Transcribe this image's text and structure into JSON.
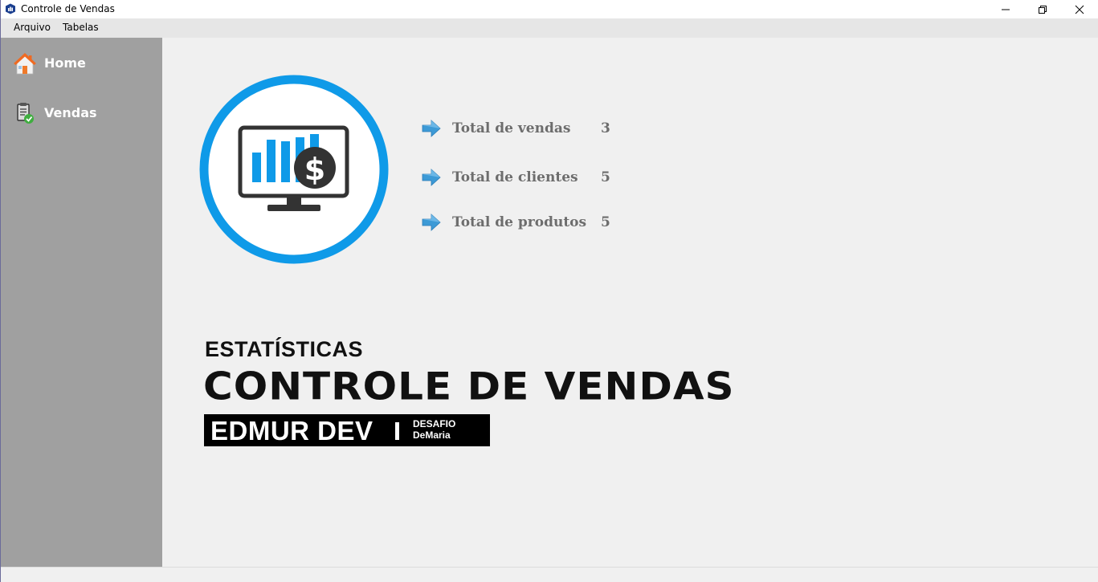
{
  "window": {
    "title": "Controle de Vendas",
    "icon": "app-chart-icon"
  },
  "menu": {
    "items": [
      {
        "label": "Arquivo"
      },
      {
        "label": "Tabelas"
      }
    ]
  },
  "sidebar": {
    "items": [
      {
        "label": "Home",
        "icon": "home-icon"
      },
      {
        "label": "Vendas",
        "icon": "clipboard-check-icon"
      }
    ]
  },
  "stats": [
    {
      "label": "Total de vendas",
      "value": "3"
    },
    {
      "label": "Total de clientes",
      "value": "5"
    },
    {
      "label": "Total de produtos",
      "value": "5"
    }
  ],
  "brand": {
    "subtitle": "ESTATÍSTICAS",
    "title": "CONTROLE DE VENDAS",
    "author": "EDMUR DEV",
    "tag_line1": "DESAFIO",
    "tag_line2": "DeMaria"
  },
  "colors": {
    "accent_blue": "#0f9ae8",
    "sidebar_bg": "#a0a0a0",
    "stat_text": "#6d6d6d"
  }
}
